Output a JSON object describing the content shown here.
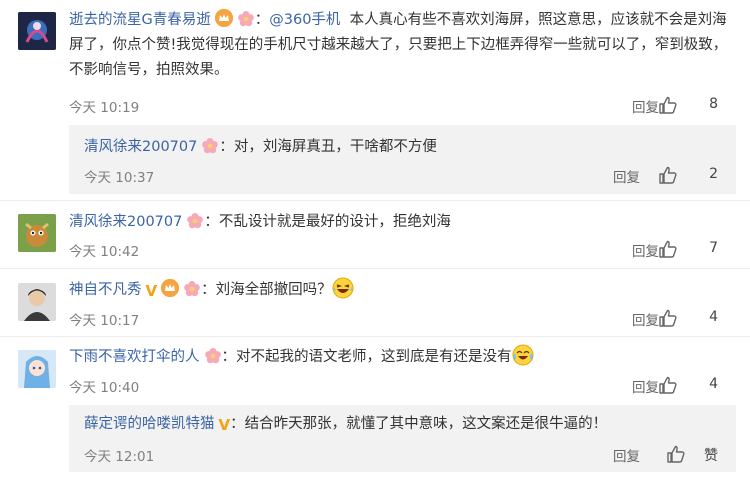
{
  "comments": [
    {
      "name": "逝去的流星G青春易逝",
      "mention": "@360手机",
      "text": "本人真心有些不喜欢刘海屏，照这意思，应该就不会是刘海屏了，你点个赞!我觉得现在的手机尺寸越来越大了，只要把上下边框弄得窄一些就可以了，窄到极致，不影响信号，拍照效果。",
      "time": "今天 10:19",
      "reply": "回复",
      "likes": "8",
      "sub": {
        "name": "清风徐来200707",
        "text": "：对，刘海屏真丑，干啥都不方便",
        "time": "今天 10:37",
        "reply": "回复",
        "likes": "2"
      }
    },
    {
      "name": "清风徐来200707",
      "text": "：不乱设计就是最好的设计，拒绝刘海",
      "time": "今天 10:42",
      "reply": "回复",
      "likes": "7"
    },
    {
      "name": "神自不凡秀",
      "text": "：刘海全部撤回吗？",
      "time": "今天 10:17",
      "reply": "回复",
      "likes": "4"
    },
    {
      "name": "下雨不喜欢打伞的人",
      "text": "：对不起我的语文老师，这到底是有还是没有",
      "time": "今天 10:40",
      "reply": "回复",
      "likes": "4",
      "sub": {
        "name": "薛定谔的哈喽凯特猫",
        "text": "：结合昨天那张，就懂了其中意味，这文案还是很牛逼的！",
        "time": "今天 12:01",
        "reply": "回复",
        "likes": "赞"
      }
    }
  ],
  "colors": {
    "name": "#3b64a5",
    "time": "#808080",
    "subbox": "#f2f2f2"
  }
}
